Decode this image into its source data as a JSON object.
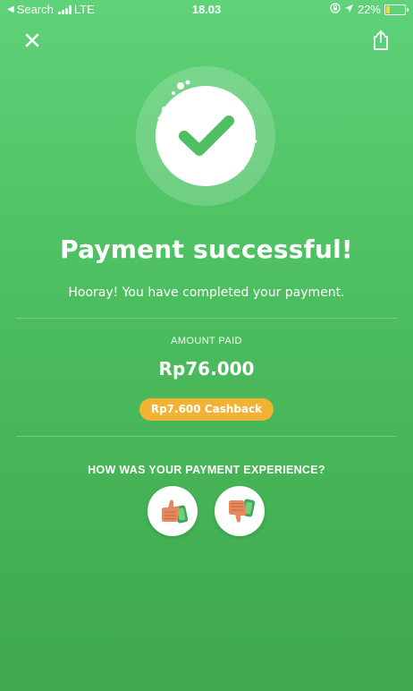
{
  "status_bar": {
    "back_app": "Search",
    "network": "LTE",
    "time": "18.03",
    "battery_percent": "22%",
    "battery_level": 0.22,
    "battery_color": "#f6d94b"
  },
  "header": {
    "close_icon": "close-icon",
    "share_icon": "share-icon"
  },
  "result": {
    "icon": "checkmark-success-icon",
    "title": "Payment successful!",
    "subtitle": "Hooray! You have completed your payment."
  },
  "payment": {
    "amount_label": "AMOUNT PAID",
    "amount_value": "Rp76.000",
    "cashback_label": "Rp7.600 Cashback"
  },
  "feedback": {
    "question": "HOW WAS YOUR PAYMENT EXPERIENCE?",
    "thumbs_up_icon": "thumbs-up-icon",
    "thumbs_down_icon": "thumbs-down-icon"
  },
  "colors": {
    "background": "#4fc263",
    "accent_check": "#4fbf61",
    "cashback_badge": "#f2b335",
    "text": "#ffffff"
  }
}
